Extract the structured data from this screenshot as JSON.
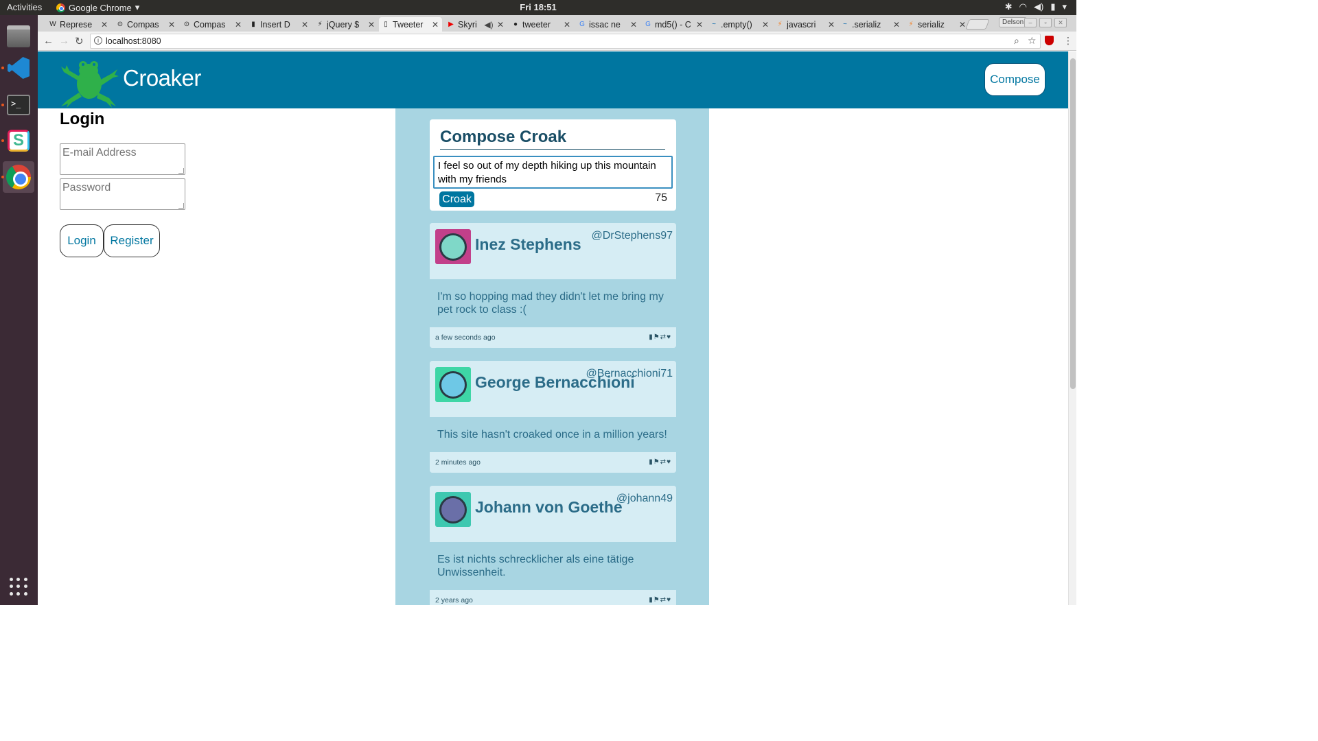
{
  "system": {
    "activities": "Activities",
    "app_name": "Google Chrome",
    "clock": "Fri 18:51"
  },
  "browser": {
    "tabs": [
      {
        "favicon": "W",
        "title": "Represe"
      },
      {
        "favicon": "⊙",
        "title": "Compas"
      },
      {
        "favicon": "⊙",
        "title": "Compas"
      },
      {
        "favicon": "▮",
        "title": "Insert D"
      },
      {
        "favicon": "⚡",
        "title": "jQuery $"
      },
      {
        "favicon": "▯",
        "title": "Tweeter"
      },
      {
        "favicon": "▶",
        "title": "Skyri"
      },
      {
        "favicon": "●",
        "title": "tweeter"
      },
      {
        "favicon": "G",
        "title": "issac ne"
      },
      {
        "favicon": "G",
        "title": "md5() - C"
      },
      {
        "favicon": "~",
        "title": ".empty()"
      },
      {
        "favicon": "⚡",
        "title": "javascri"
      },
      {
        "favicon": "~",
        "title": ".serializ"
      },
      {
        "favicon": "⚡",
        "title": "serializ"
      }
    ],
    "profile": "Delson",
    "url": "localhost:8080"
  },
  "site": {
    "brand": "Croaker",
    "compose_nav": "Compose",
    "login": {
      "title": "Login",
      "email_placeholder": "E-mail Address",
      "password_placeholder": "Password",
      "login_button": "Login",
      "register_button": "Register"
    },
    "compose": {
      "title": "Compose Croak",
      "text": "I feel so out of my depth hiking up this mountain with my friends",
      "button": "Croak",
      "counter": "75"
    },
    "tweets": [
      {
        "name": "Inez Stephens",
        "handle": "@DrStephens97",
        "body": "I'm so hopping mad they didn't let me bring my pet rock to class :(",
        "time": "a few seconds ago",
        "avatar_color": "#c2408a",
        "face_color": "#7fd8c8"
      },
      {
        "name": "George Bernacchioni",
        "handle": "@Bernacchioni71",
        "body": "This site hasn't croaked once in a million years!",
        "time": "2 minutes ago",
        "avatar_color": "#3ed6a6",
        "face_color": "#6ec8e6"
      },
      {
        "name": "Johann von Goethe",
        "handle": "@johann49",
        "body": "Es ist nichts schrecklicher als eine tätige Unwissenheit.",
        "time": "2 years ago",
        "avatar_color": "#3ec8b0",
        "face_color": "#6a6fa8"
      }
    ]
  },
  "colors": {
    "header": "#0076a0",
    "feed_bg": "#a8d5e2",
    "card_bg": "#d6edf4"
  }
}
